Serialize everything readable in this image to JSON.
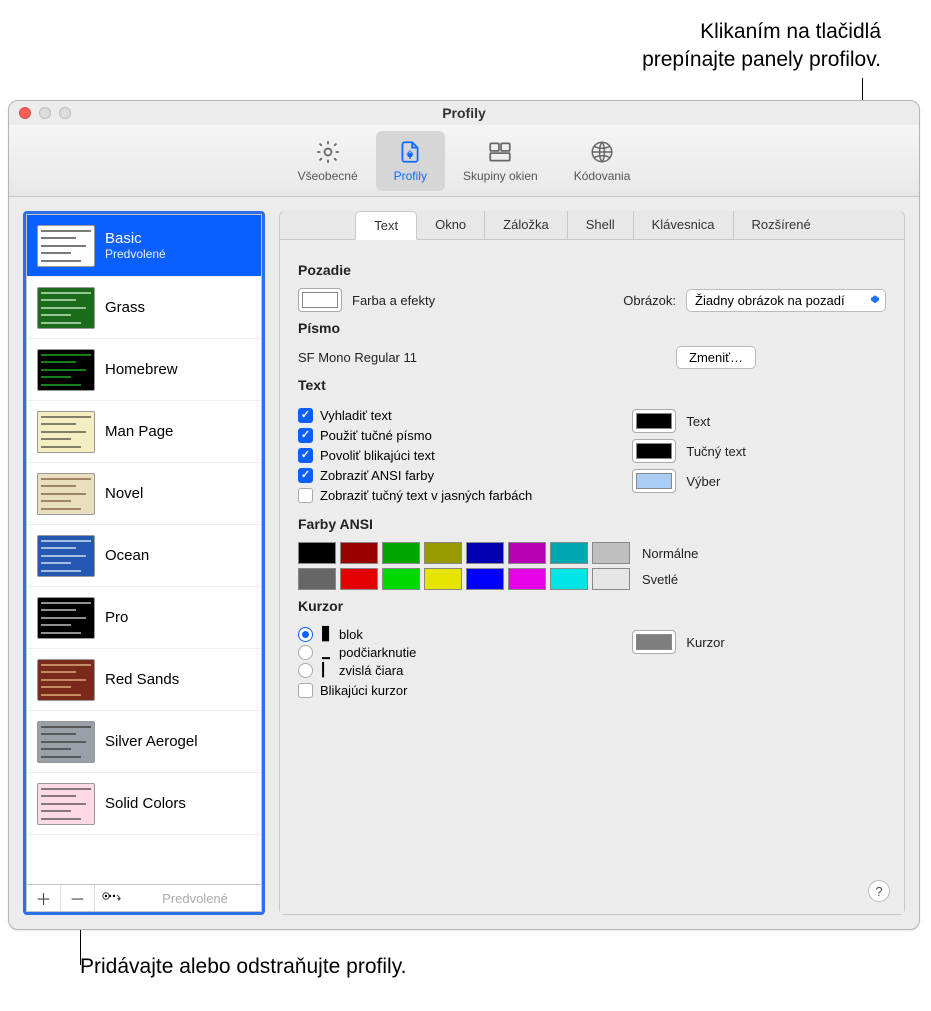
{
  "callouts": {
    "top": "Klikaním na tlačidlá\nprepínajte panely profilov.",
    "bottom": "Pridávajte alebo odstraňujte profily."
  },
  "window": {
    "title": "Profily"
  },
  "toolbar": {
    "items": [
      {
        "label": "Všeobecné",
        "icon": "gear-icon"
      },
      {
        "label": "Profily",
        "icon": "profile-icon"
      },
      {
        "label": "Skupiny okien",
        "icon": "window-group-icon"
      },
      {
        "label": "Kódovania",
        "icon": "globe-icon"
      }
    ],
    "active_index": 1
  },
  "sidebar": {
    "profiles": [
      {
        "name": "Basic",
        "subtitle": "Predvolené",
        "thumb_bg": "#ffffff",
        "thumb_fg": "#222222",
        "selected": true
      },
      {
        "name": "Grass",
        "thumb_bg": "#1a6b1a",
        "thumb_fg": "#eaffea"
      },
      {
        "name": "Homebrew",
        "thumb_bg": "#000000",
        "thumb_fg": "#24d424"
      },
      {
        "name": "Man Page",
        "thumb_bg": "#f5eec0",
        "thumb_fg": "#333333"
      },
      {
        "name": "Novel",
        "thumb_bg": "#e9dfbf",
        "thumb_fg": "#6a4a2a"
      },
      {
        "name": "Ocean",
        "thumb_bg": "#2458b3",
        "thumb_fg": "#ffffff"
      },
      {
        "name": "Pro",
        "thumb_bg": "#000000",
        "thumb_fg": "#f2f2f2"
      },
      {
        "name": "Red Sands",
        "thumb_bg": "#7a2a1a",
        "thumb_fg": "#f0d090"
      },
      {
        "name": "Silver Aerogel",
        "thumb_bg": "#9aa0a8",
        "thumb_fg": "#2a2a2a"
      },
      {
        "name": "Solid Colors",
        "thumb_bg": "#ffd9e4",
        "thumb_fg": "#333333"
      }
    ],
    "footer": {
      "default_label": "Predvolené"
    }
  },
  "tabs": {
    "items": [
      "Text",
      "Okno",
      "Záložka",
      "Shell",
      "Klávesnica",
      "Rozšírené"
    ],
    "active_index": 0
  },
  "pane": {
    "background": {
      "title": "Pozadie",
      "color_effects_label": "Farba a efekty",
      "color_value": "#ffffff",
      "image_label": "Obrázok:",
      "image_select_value": "Žiadny obrázok na pozadí"
    },
    "font": {
      "title": "Písmo",
      "value": "SF Mono Regular 11",
      "change_label": "Zmeniť…"
    },
    "text": {
      "title": "Text",
      "checkboxes": [
        {
          "label": "Vyhladiť text",
          "checked": true
        },
        {
          "label": "Použiť tučné písmo",
          "checked": true
        },
        {
          "label": "Povoliť blikajúci text",
          "checked": true
        },
        {
          "label": "Zobraziť ANSI farby",
          "checked": true
        },
        {
          "label": "Zobraziť tučný text v jasných farbách",
          "checked": false
        }
      ],
      "colors": [
        {
          "label": "Text",
          "value": "#000000"
        },
        {
          "label": "Tučný text",
          "value": "#000000"
        },
        {
          "label": "Výber",
          "value": "#a9cdf5"
        }
      ]
    },
    "ansi": {
      "title": "Farby ANSI",
      "normal_label": "Normálne",
      "bright_label": "Svetlé",
      "normal": [
        "#000000",
        "#990000",
        "#00a600",
        "#999900",
        "#0000b2",
        "#b200b2",
        "#00a6b2",
        "#bfbfbf"
      ],
      "bright": [
        "#666666",
        "#e50000",
        "#00d900",
        "#e5e500",
        "#0000ff",
        "#e500e5",
        "#00e5e5",
        "#e5e5e5"
      ]
    },
    "cursor": {
      "title": "Kurzor",
      "options": [
        {
          "label": "blok",
          "glyph": "▉",
          "checked": true
        },
        {
          "label": "podčiarknutie",
          "glyph": "▁",
          "checked": false
        },
        {
          "label": "zvislá čiara",
          "glyph": "▎",
          "checked": false
        }
      ],
      "blink_label": "Blikajúci kurzor",
      "blink_checked": false,
      "color_label": "Kurzor",
      "color_value": "#7f7f7f"
    },
    "help_glyph": "?"
  }
}
